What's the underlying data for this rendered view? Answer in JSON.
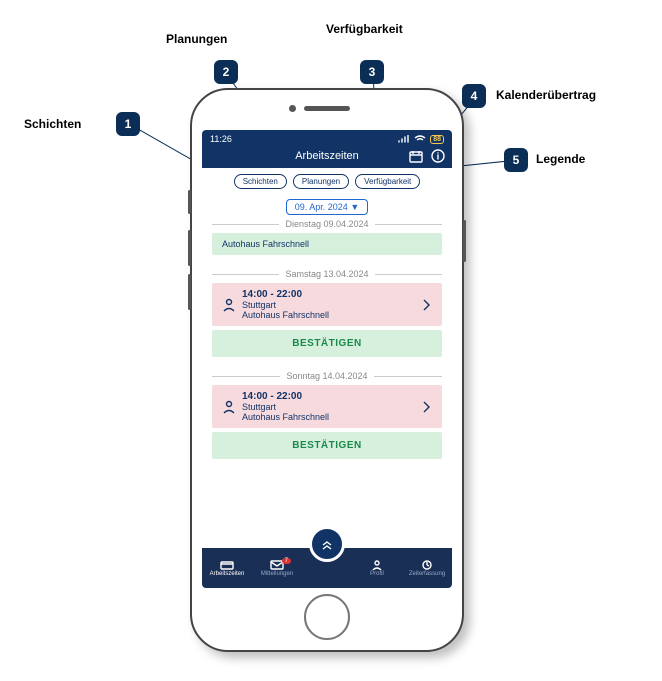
{
  "callouts": {
    "c1": {
      "num": "1",
      "label": "Schichten"
    },
    "c2": {
      "num": "2",
      "label": "Planungen"
    },
    "c3": {
      "num": "3",
      "label": "Verfügbarkeit"
    },
    "c4": {
      "num": "4",
      "label": "Kalenderübertrag"
    },
    "c5": {
      "num": "5",
      "label": "Legende"
    }
  },
  "statusbar": {
    "time": "11:26",
    "battery": "88"
  },
  "header": {
    "title": "Arbeitszeiten"
  },
  "tabs": {
    "t1": "Schichten",
    "t2": "Planungen",
    "t3": "Verfügbarkeit"
  },
  "datepicker": {
    "label": "09. Apr. 2024 ▼"
  },
  "days": {
    "d1": {
      "header": "Dienstag 09.04.2024",
      "bar_text": "Autohaus Fahrschnell"
    },
    "d2": {
      "header": "Samstag 13.04.2024",
      "time": "14:00 - 22:00",
      "city": "Stuttgart",
      "company": "Autohaus Fahrschnell",
      "confirm": "BESTÄTIGEN"
    },
    "d3": {
      "header": "Sonntag 14.04.2024",
      "time": "14:00 - 22:00",
      "city": "Stuttgart",
      "company": "Autohaus Fahrschnell",
      "confirm": "BESTÄTIGEN"
    }
  },
  "bottomnav": {
    "i1": "Arbeitszeiten",
    "i2": "Mitteilungen",
    "i2_badge": "7",
    "i3": "Profil",
    "i4": "Zeiterfassung"
  }
}
